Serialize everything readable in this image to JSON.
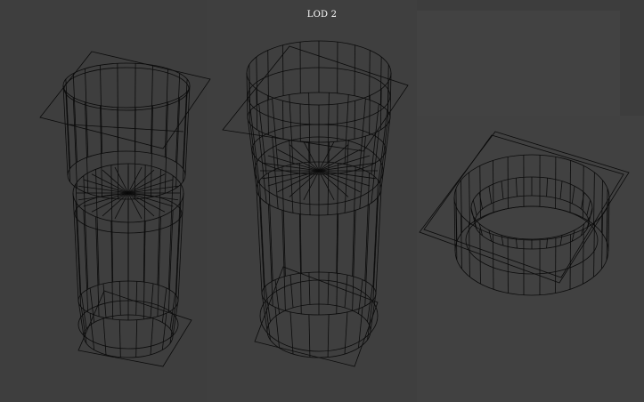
{
  "viewport": {
    "title": "LOD 2",
    "background_color": "#3d3d3d",
    "panel_color": "#404040",
    "wire_color": "#0b0b0b",
    "title_color": "#ffffff"
  },
  "objects": [
    {
      "name": "glass-lod-left"
    },
    {
      "name": "glass-lod-middle"
    },
    {
      "name": "glass-lod-right"
    }
  ]
}
